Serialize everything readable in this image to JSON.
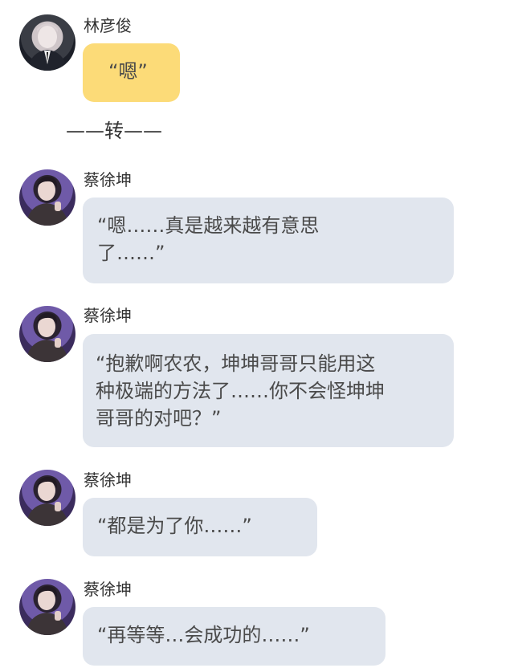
{
  "colors": {
    "yellow_bubble": "#fcdb78",
    "gray_bubble": "#e1e6ee",
    "background": "#ffffff"
  },
  "messages": [
    {
      "name": "林彦俊",
      "text": "“嗯”",
      "avatar": "person-avatar"
    },
    {
      "name": "蔡徐坤",
      "text": "“嗯……真是越来越有意思\n了……”",
      "avatar": "person-avatar"
    },
    {
      "name": "蔡徐坤",
      "text": "“抱歉啊农农，坤坤哥哥只能用这\n种极端的方法了……你不会怪坤坤\n哥哥的对吧？”",
      "avatar": "person-avatar"
    },
    {
      "name": "蔡徐坤",
      "text": "“都是为了你……”",
      "avatar": "person-avatar"
    },
    {
      "name": "蔡徐坤",
      "text": "“再等等…会成功的……”",
      "avatar": "person-avatar"
    }
  ],
  "divider": "——转——"
}
